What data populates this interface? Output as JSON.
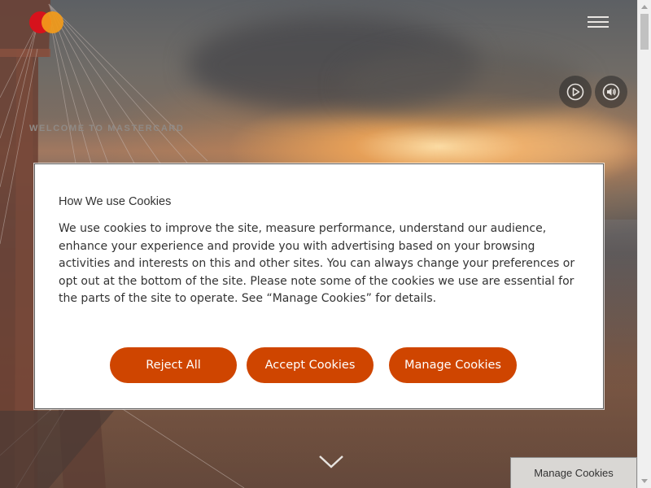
{
  "header": {
    "logo_name": "mastercard-logo",
    "menu_icon": "hamburger-menu-icon"
  },
  "hero": {
    "eyebrow": "WELCOME TO MASTERCARD",
    "play_icon": "play-icon",
    "sound_icon": "volume-icon",
    "scroll_icon": "chevron-down-icon"
  },
  "cookie_dialog": {
    "title": "How We use Cookies",
    "body": "We use cookies to improve the site, measure performance, understand our audience, enhance your experience and provide you with advertising based on your browsing activities and interests on this and other sites. You can always change your preferences or opt out at the bottom of the site. Please note some of the cookies we use are essential for the parts of the site to operate. See “Manage Cookies” for details.",
    "buttons": {
      "reject": "Reject All",
      "accept": "Accept Cookies",
      "manage": "Manage Cookies"
    }
  },
  "footer_tab": {
    "label": "Manage Cookies"
  },
  "colors": {
    "accent": "#cf4500",
    "logo_red": "#d6121c",
    "logo_orange": "#f39b1a"
  }
}
